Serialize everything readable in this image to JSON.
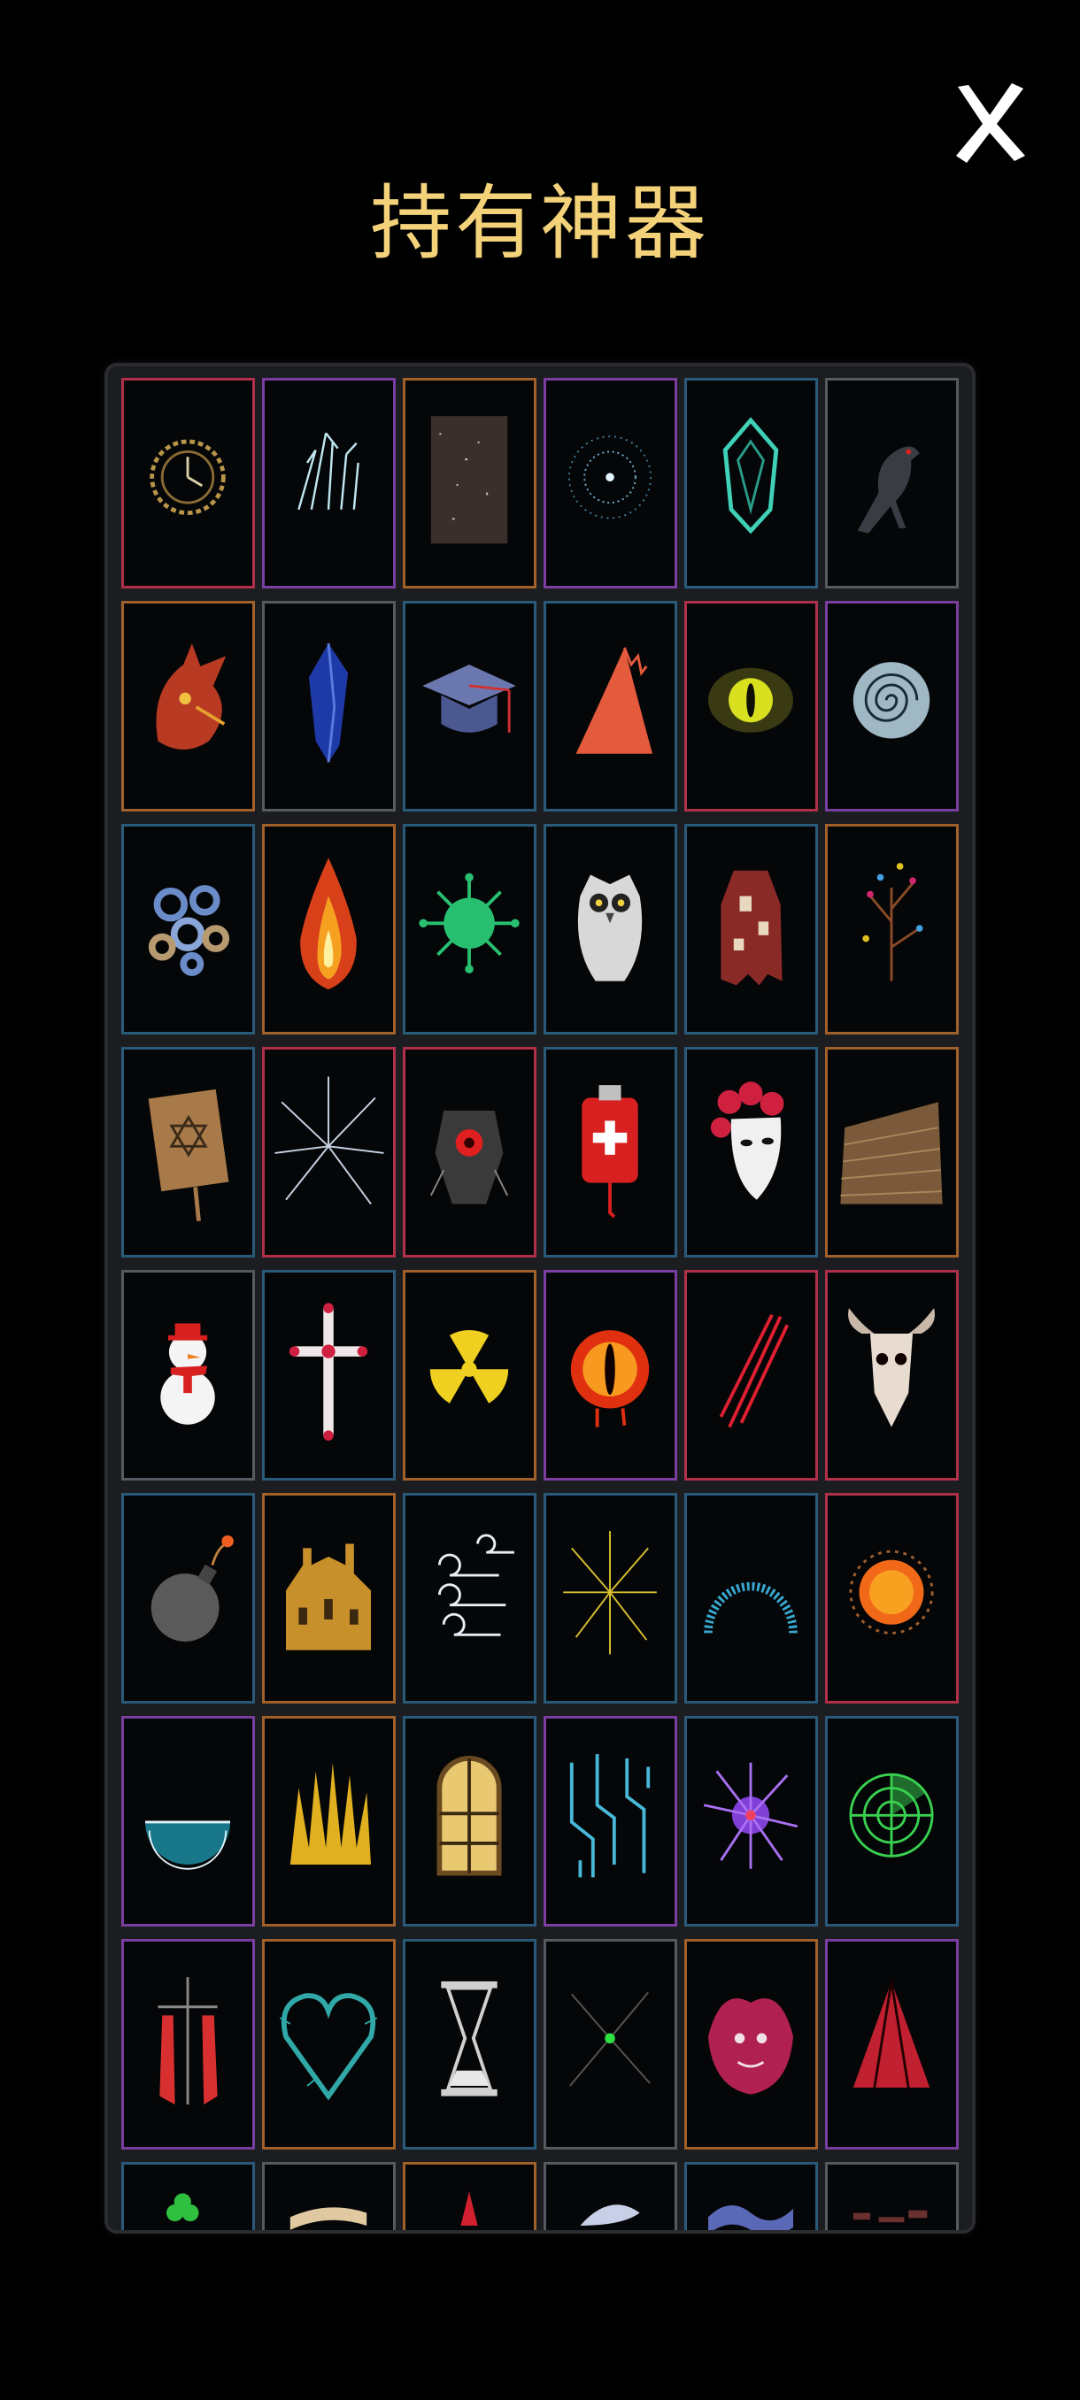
{
  "header": {
    "title": "持有神器",
    "close_icon": "close-x-icon"
  },
  "artifacts": [
    {
      "icon": "clock-icon",
      "frame": "#b0304a"
    },
    {
      "icon": "frost-crystal-icon",
      "frame": "#7a3ea0"
    },
    {
      "icon": "static-noise-icon",
      "frame": "#a0602a"
    },
    {
      "icon": "starburst-icon",
      "frame": "#7a3ea0"
    },
    {
      "icon": "green-gem-icon",
      "frame": "#2a5a7a"
    },
    {
      "icon": "raven-icon",
      "frame": "#555a60"
    },
    {
      "icon": "red-dragon-icon",
      "frame": "#a0602a"
    },
    {
      "icon": "blue-crystal-icon",
      "frame": "#555a60"
    },
    {
      "icon": "graduation-cap-icon",
      "frame": "#2a5a7a"
    },
    {
      "icon": "orange-shark-fin-icon",
      "frame": "#2a5a7a"
    },
    {
      "icon": "yellow-eye-icon",
      "frame": "#b0304a"
    },
    {
      "icon": "spiral-orb-icon",
      "frame": "#7a3ea0"
    },
    {
      "icon": "gears-icon",
      "frame": "#2a5a7a"
    },
    {
      "icon": "flame-icon",
      "frame": "#a0602a"
    },
    {
      "icon": "green-virus-icon",
      "frame": "#2a5a7a"
    },
    {
      "icon": "owl-icon",
      "frame": "#2a5a7a"
    },
    {
      "icon": "tattered-robe-icon",
      "frame": "#2a5a7a"
    },
    {
      "icon": "confetti-tree-icon",
      "frame": "#a0602a"
    },
    {
      "icon": "rune-tablet-icon",
      "frame": "#2a5a7a"
    },
    {
      "icon": "shattered-glass-icon",
      "frame": "#b0304a"
    },
    {
      "icon": "red-eye-machine-icon",
      "frame": "#b0304a"
    },
    {
      "icon": "blood-bag-icon",
      "frame": "#2a5a7a"
    },
    {
      "icon": "rose-mask-icon",
      "frame": "#2a5a7a"
    },
    {
      "icon": "woven-basket-icon",
      "frame": "#a0602a"
    },
    {
      "icon": "snowman-icon",
      "frame": "#555a60"
    },
    {
      "icon": "cross-icon",
      "frame": "#2a5a7a"
    },
    {
      "icon": "radiation-icon",
      "frame": "#a0602a"
    },
    {
      "icon": "fire-eye-icon",
      "frame": "#7a3ea0"
    },
    {
      "icon": "red-claw-slash-icon",
      "frame": "#b0304a"
    },
    {
      "icon": "goat-skull-icon",
      "frame": "#b0304a"
    },
    {
      "icon": "bomb-icon",
      "frame": "#2a5a7a"
    },
    {
      "icon": "golden-ruins-icon",
      "frame": "#a0602a"
    },
    {
      "icon": "wind-swirls-icon",
      "frame": "#2a5a7a"
    },
    {
      "icon": "yellow-sparks-icon",
      "frame": "#2a5a7a"
    },
    {
      "icon": "blue-dome-icon",
      "frame": "#2a5a7a"
    },
    {
      "icon": "sun-orb-icon",
      "frame": "#b0304a"
    },
    {
      "icon": "water-bowl-icon",
      "frame": "#7a3ea0"
    },
    {
      "icon": "golden-crown-icon",
      "frame": "#a0602a"
    },
    {
      "icon": "stained-glass-window-icon",
      "frame": "#2a5a7a"
    },
    {
      "icon": "circuit-icon",
      "frame": "#7a3ea0"
    },
    {
      "icon": "purple-urchin-icon",
      "frame": "#2a5a7a"
    },
    {
      "icon": "radar-icon",
      "frame": "#2a5a7a"
    },
    {
      "icon": "bloody-scarecrow-icon",
      "frame": "#7a3ea0"
    },
    {
      "icon": "thorn-heart-icon",
      "frame": "#a0602a"
    },
    {
      "icon": "hourglass-icon",
      "frame": "#2a5a7a"
    },
    {
      "icon": "green-spark-icon",
      "frame": "#555a60"
    },
    {
      "icon": "red-jester-icon",
      "frame": "#a0602a"
    },
    {
      "icon": "red-tent-icon",
      "frame": "#7a3ea0"
    },
    {
      "icon": "green-clover-icon",
      "frame": "#2a5a7a"
    },
    {
      "icon": "scroll-icon",
      "frame": "#555a60"
    },
    {
      "icon": "red-spike-icon",
      "frame": "#a0602a"
    },
    {
      "icon": "white-feather-icon",
      "frame": "#555a60"
    },
    {
      "icon": "blue-wave-icon",
      "frame": "#2a5a7a"
    },
    {
      "icon": "dark-debris-icon",
      "frame": "#555a60"
    }
  ]
}
